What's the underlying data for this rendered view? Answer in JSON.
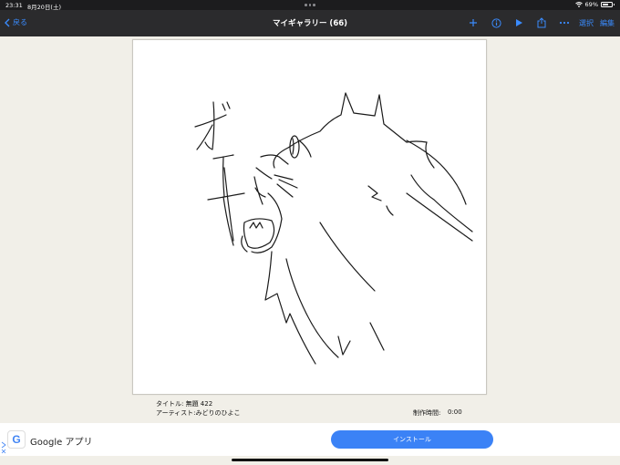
{
  "status_bar": {
    "time": "23:31",
    "date": "8月20日(土)",
    "battery_pct": "69%",
    "battery_level": 0.69
  },
  "nav": {
    "back_label": "戻る",
    "title": "マイギャラリー (66)",
    "select_label": "選択",
    "edit_label": "編集",
    "icons": [
      "plus-icon",
      "info-icon",
      "play-icon",
      "share-icon",
      "more-icon"
    ]
  },
  "artwork": {
    "text": "オエー"
  },
  "info": {
    "title_line": "タイトル: 無題 422",
    "artist_line": "アーティスト:みどりのひよこ",
    "time_label": "制作時間:",
    "time_value": "0:00"
  },
  "ad": {
    "logo_letter": "G",
    "app_name": "Google アプリ",
    "install_label": "インストール",
    "accent": "#3b82f6"
  }
}
